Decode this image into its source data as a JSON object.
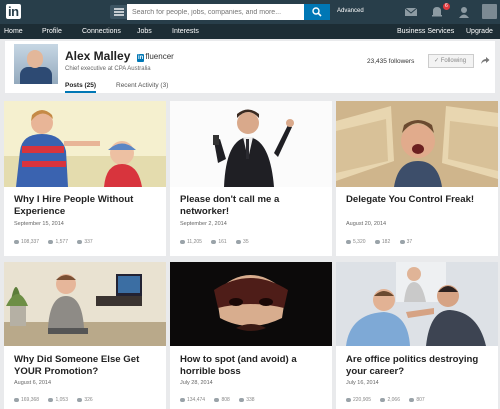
{
  "topbar": {
    "logo_text": "in",
    "search_placeholder": "Search for people, jobs, companies, and more...",
    "advanced_label": "Advanced",
    "notification_count": "6"
  },
  "nav": {
    "items": [
      "Home",
      "Profile",
      "Connections",
      "Jobs",
      "Interests",
      "Business Services",
      "Upgrade"
    ]
  },
  "profile": {
    "name": "Alex Malley",
    "influencer_badge": "in",
    "influencer_label": "fluencer",
    "job_title": "Chief executive at CPA Australia",
    "followers": "23,435 followers",
    "follow_button": "✓ Following",
    "tabs": [
      "Posts (25)",
      "Recent Activity (3)"
    ]
  },
  "posts": [
    {
      "title": "Why I Hire People Without Experience",
      "date": "September 15, 2014",
      "views": "108,337",
      "likes": "1,577",
      "comments": "337",
      "image": "children-scene"
    },
    {
      "title": "Please don't call me a networker!",
      "date": "September 2, 2014",
      "views": "11,205",
      "likes": "161",
      "comments": "35",
      "image": "businessman-on-phone"
    },
    {
      "title": "Delegate You Control Freak!",
      "date": "August 20, 2014",
      "views": "5,320",
      "likes": "182",
      "comments": "37",
      "image": "man-with-papers"
    },
    {
      "title": "Why Did Someone Else Get YOUR Promotion?",
      "date": "August 6, 2014",
      "views": "169,368",
      "likes": "1,053",
      "comments": "326",
      "image": "crying-child-office"
    },
    {
      "title": "How to spot (and avoid) a horrible boss",
      "date": "July 28, 2014",
      "views": "134,474",
      "likes": "808",
      "comments": "338",
      "image": "masked-man"
    },
    {
      "title": "Are office politics destroying your career?",
      "date": "July 16, 2014",
      "views": "220,905",
      "likes": "2,066",
      "comments": "807",
      "image": "office-argument"
    }
  ],
  "colors": {
    "topbar": "#283e4a",
    "navbar": "#1d2d35",
    "accent": "#0077b5",
    "badge": "#e0393e"
  }
}
